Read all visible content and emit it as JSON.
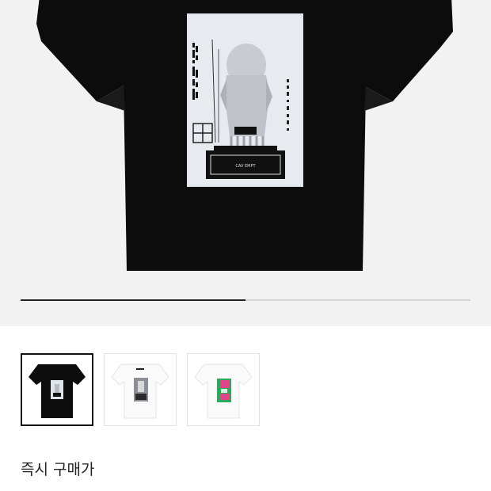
{
  "product": {
    "main_image": "black-tshirt-back-graphic-print",
    "graphic_text": "CAV EMPT",
    "carousel_progress": 0.5,
    "thumbnails": [
      {
        "image": "black-tshirt-thumbnail",
        "selected": true
      },
      {
        "image": "white-tshirt-bw-graphic-thumbnail",
        "selected": false
      },
      {
        "image": "white-tshirt-green-pink-graphic-thumbnail",
        "selected": false
      }
    ]
  },
  "pricing": {
    "instant_buy_label": "즉시 구매가"
  },
  "colors": {
    "hero_bg": "#f2f2f2",
    "shirt_black": "#0c0c0c",
    "accent_green": "#2bab5a",
    "accent_pink": "#e0458a"
  }
}
